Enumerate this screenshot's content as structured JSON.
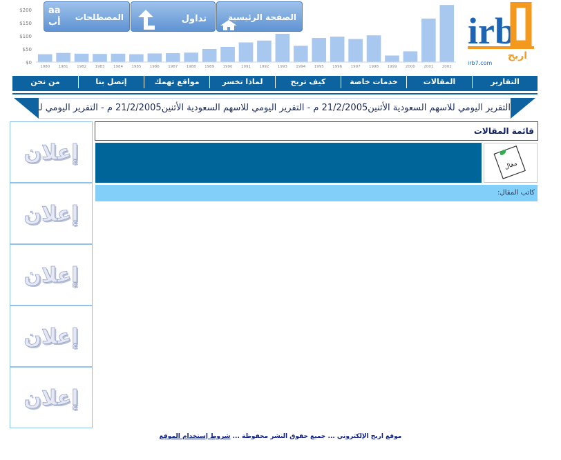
{
  "header": {
    "chart": {
      "y_ticks": [
        "$200",
        "$150",
        "$100",
        "$50",
        "$0"
      ],
      "years": [
        "1980",
        "1981",
        "1982",
        "1983",
        "1984",
        "1985",
        "1986",
        "1987",
        "1988",
        "1989",
        "1990",
        "1991",
        "1992",
        "1993",
        "1994",
        "1995",
        "1996",
        "1997",
        "1998",
        "1999",
        "2000",
        "2001",
        "2002"
      ],
      "values": [
        30,
        35,
        32,
        31,
        32,
        30,
        33,
        34,
        36,
        50,
        58,
        75,
        82,
        108,
        62,
        92,
        97,
        88,
        102,
        25,
        41,
        166,
        218
      ],
      "bar_color": "#a9c8ef"
    },
    "buttons": {
      "home_label": "الصفحة الرئيسية",
      "trading_label": "تداول",
      "glossary_label": "المصطلحات",
      "glossary_glyph": "aa أب"
    },
    "logo": {
      "domain": "irb7.com",
      "mark": "irb",
      "arabic": "اربح",
      "colors": {
        "blue": "#1b64b6",
        "orange": "#f39a1e"
      }
    }
  },
  "nav": {
    "items": [
      "التقارير",
      "المقالات",
      "خدمات خاصة",
      "كيف تربح",
      "لماذا تخسر",
      "مواقع تهمك",
      "إتصل بنا",
      "من نحن"
    ]
  },
  "ticker": {
    "text": "التقرير اليومي للاسهم السعودية الأثنين21/2/2005 م - التقرير اليومي للاسهم السعودية الأثنين21/2/2005 م - التقرير اليومي للاسهم السعودية"
  },
  "ads": {
    "label": "إعلان",
    "count": 5
  },
  "main": {
    "section_title": "قائمة المقالات",
    "article_icon_label": "مقال",
    "author_label": "كاتب المقال:"
  },
  "footer": {
    "site_text": "موقع اربح الإلكتروني ... جميع حقوق النشر محفوظة ...",
    "terms_link": "شروط إستخدام الموقع"
  }
}
